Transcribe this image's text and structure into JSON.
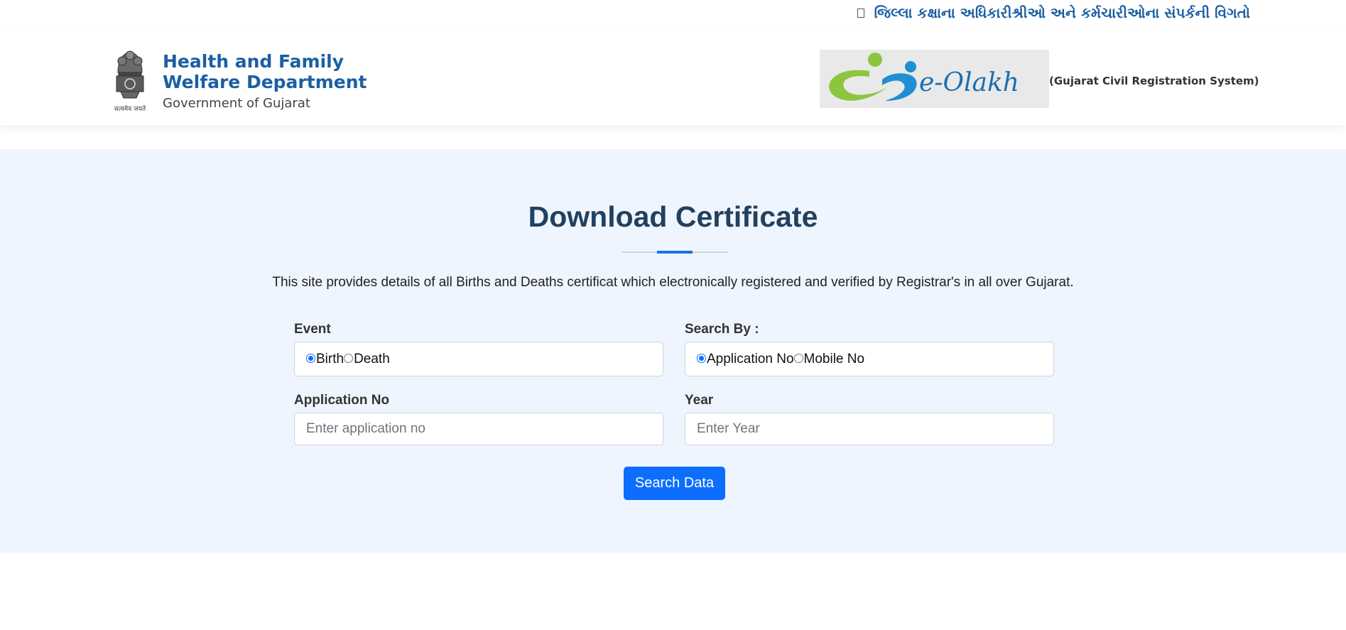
{
  "topbar": {
    "contact_link": "જિલ્લા કક્ષાના અધિકારીશ્રીઓ અને કર્મચારીઓના સંપર્કની વિગતો",
    "contact_icon": "phone-icon"
  },
  "header": {
    "dept_name": "Health and Family Welfare Department",
    "dept_gov": "Government of Gujarat",
    "emblem_motto": "सत्यमेव जयते",
    "olakh_logo_text": "e-Olakh",
    "olakh_caption": "(Gujarat Civil Registration System)"
  },
  "main": {
    "title": "Download Certificate",
    "intro": "This site provides details of all Births and Deaths certificat which electronically registered and verified by Registrar's in all over Gujarat.",
    "event": {
      "label": "Event",
      "options": [
        "Birth",
        "Death"
      ],
      "selected": "Birth"
    },
    "search_by": {
      "label": "Search By :",
      "options": [
        "Application No",
        "Mobile No"
      ],
      "selected": "Application No"
    },
    "application_no": {
      "label": "Application No",
      "placeholder": "Enter application no",
      "value": ""
    },
    "year": {
      "label": "Year",
      "placeholder": "Enter Year",
      "value": ""
    },
    "search_button": "Search Data"
  },
  "colors": {
    "accent": "#0d6efd",
    "title": "#23405e",
    "dept_blue": "#1b5fa3",
    "section_bg": "#eef5fe",
    "olakh_green": "#8cc63f"
  }
}
